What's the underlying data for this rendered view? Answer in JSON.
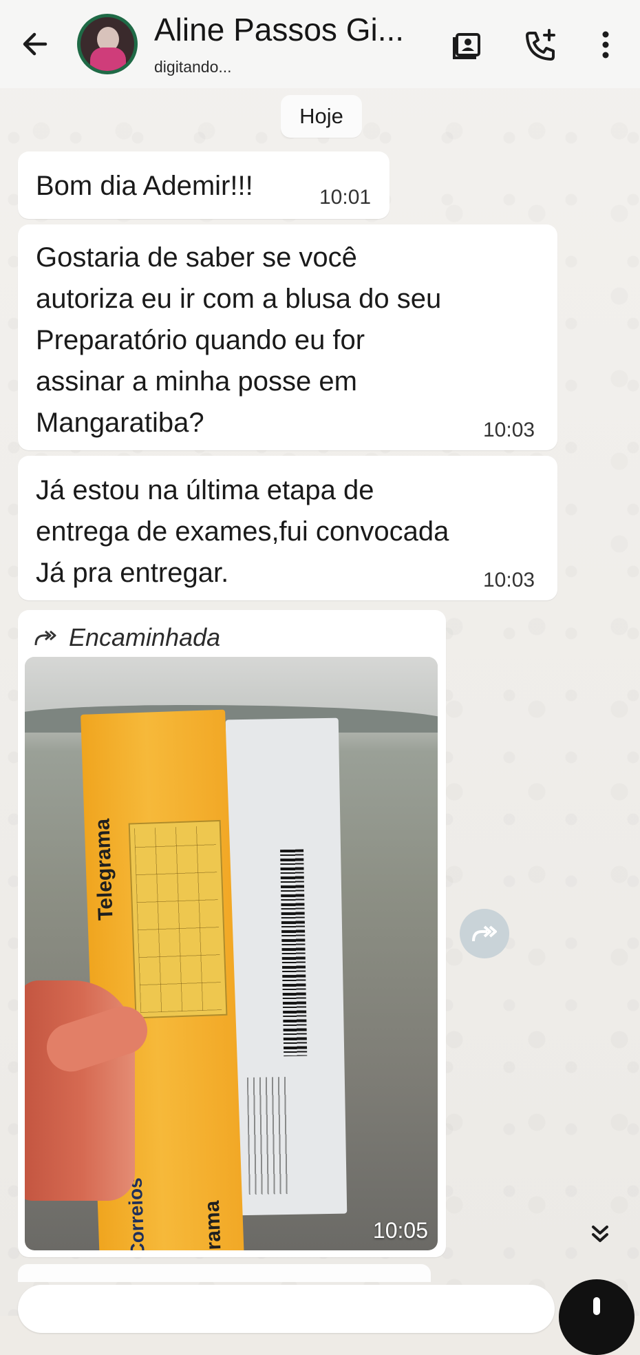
{
  "header": {
    "contact_name": "Aline Passos Gi...",
    "status": "digitando...",
    "icons": [
      "arrow-left-icon",
      "contact-card-icon",
      "add-call-icon",
      "more-vertical-icon"
    ]
  },
  "date_chip": "Hoje",
  "messages": [
    {
      "text": "Bom dia Ademir!!!",
      "time": "10:01"
    },
    {
      "text": "Gostaria de saber se você\nautoriza eu ir com a blusa do seu\nPreparatório quando eu for\nassinar a minha posse em\nMangaratiba?",
      "time": "10:03"
    },
    {
      "text": "Já estou na última etapa de\nentrega de exames,fui convocada\nJá pra entregar.",
      "time": "10:03"
    }
  ],
  "media_message": {
    "forwarded_label": "Encaminhada",
    "time": "10:05",
    "photo_texts": {
      "label_top": "Telegrama",
      "label_bottom": "Telegrama",
      "brand": "Correios"
    }
  },
  "colors": {
    "header_bg": "#f6f6f5",
    "bubble_bg": "#ffffff",
    "avatar_ring": "#1f6a46",
    "chat_bg": "#eeebe6"
  }
}
